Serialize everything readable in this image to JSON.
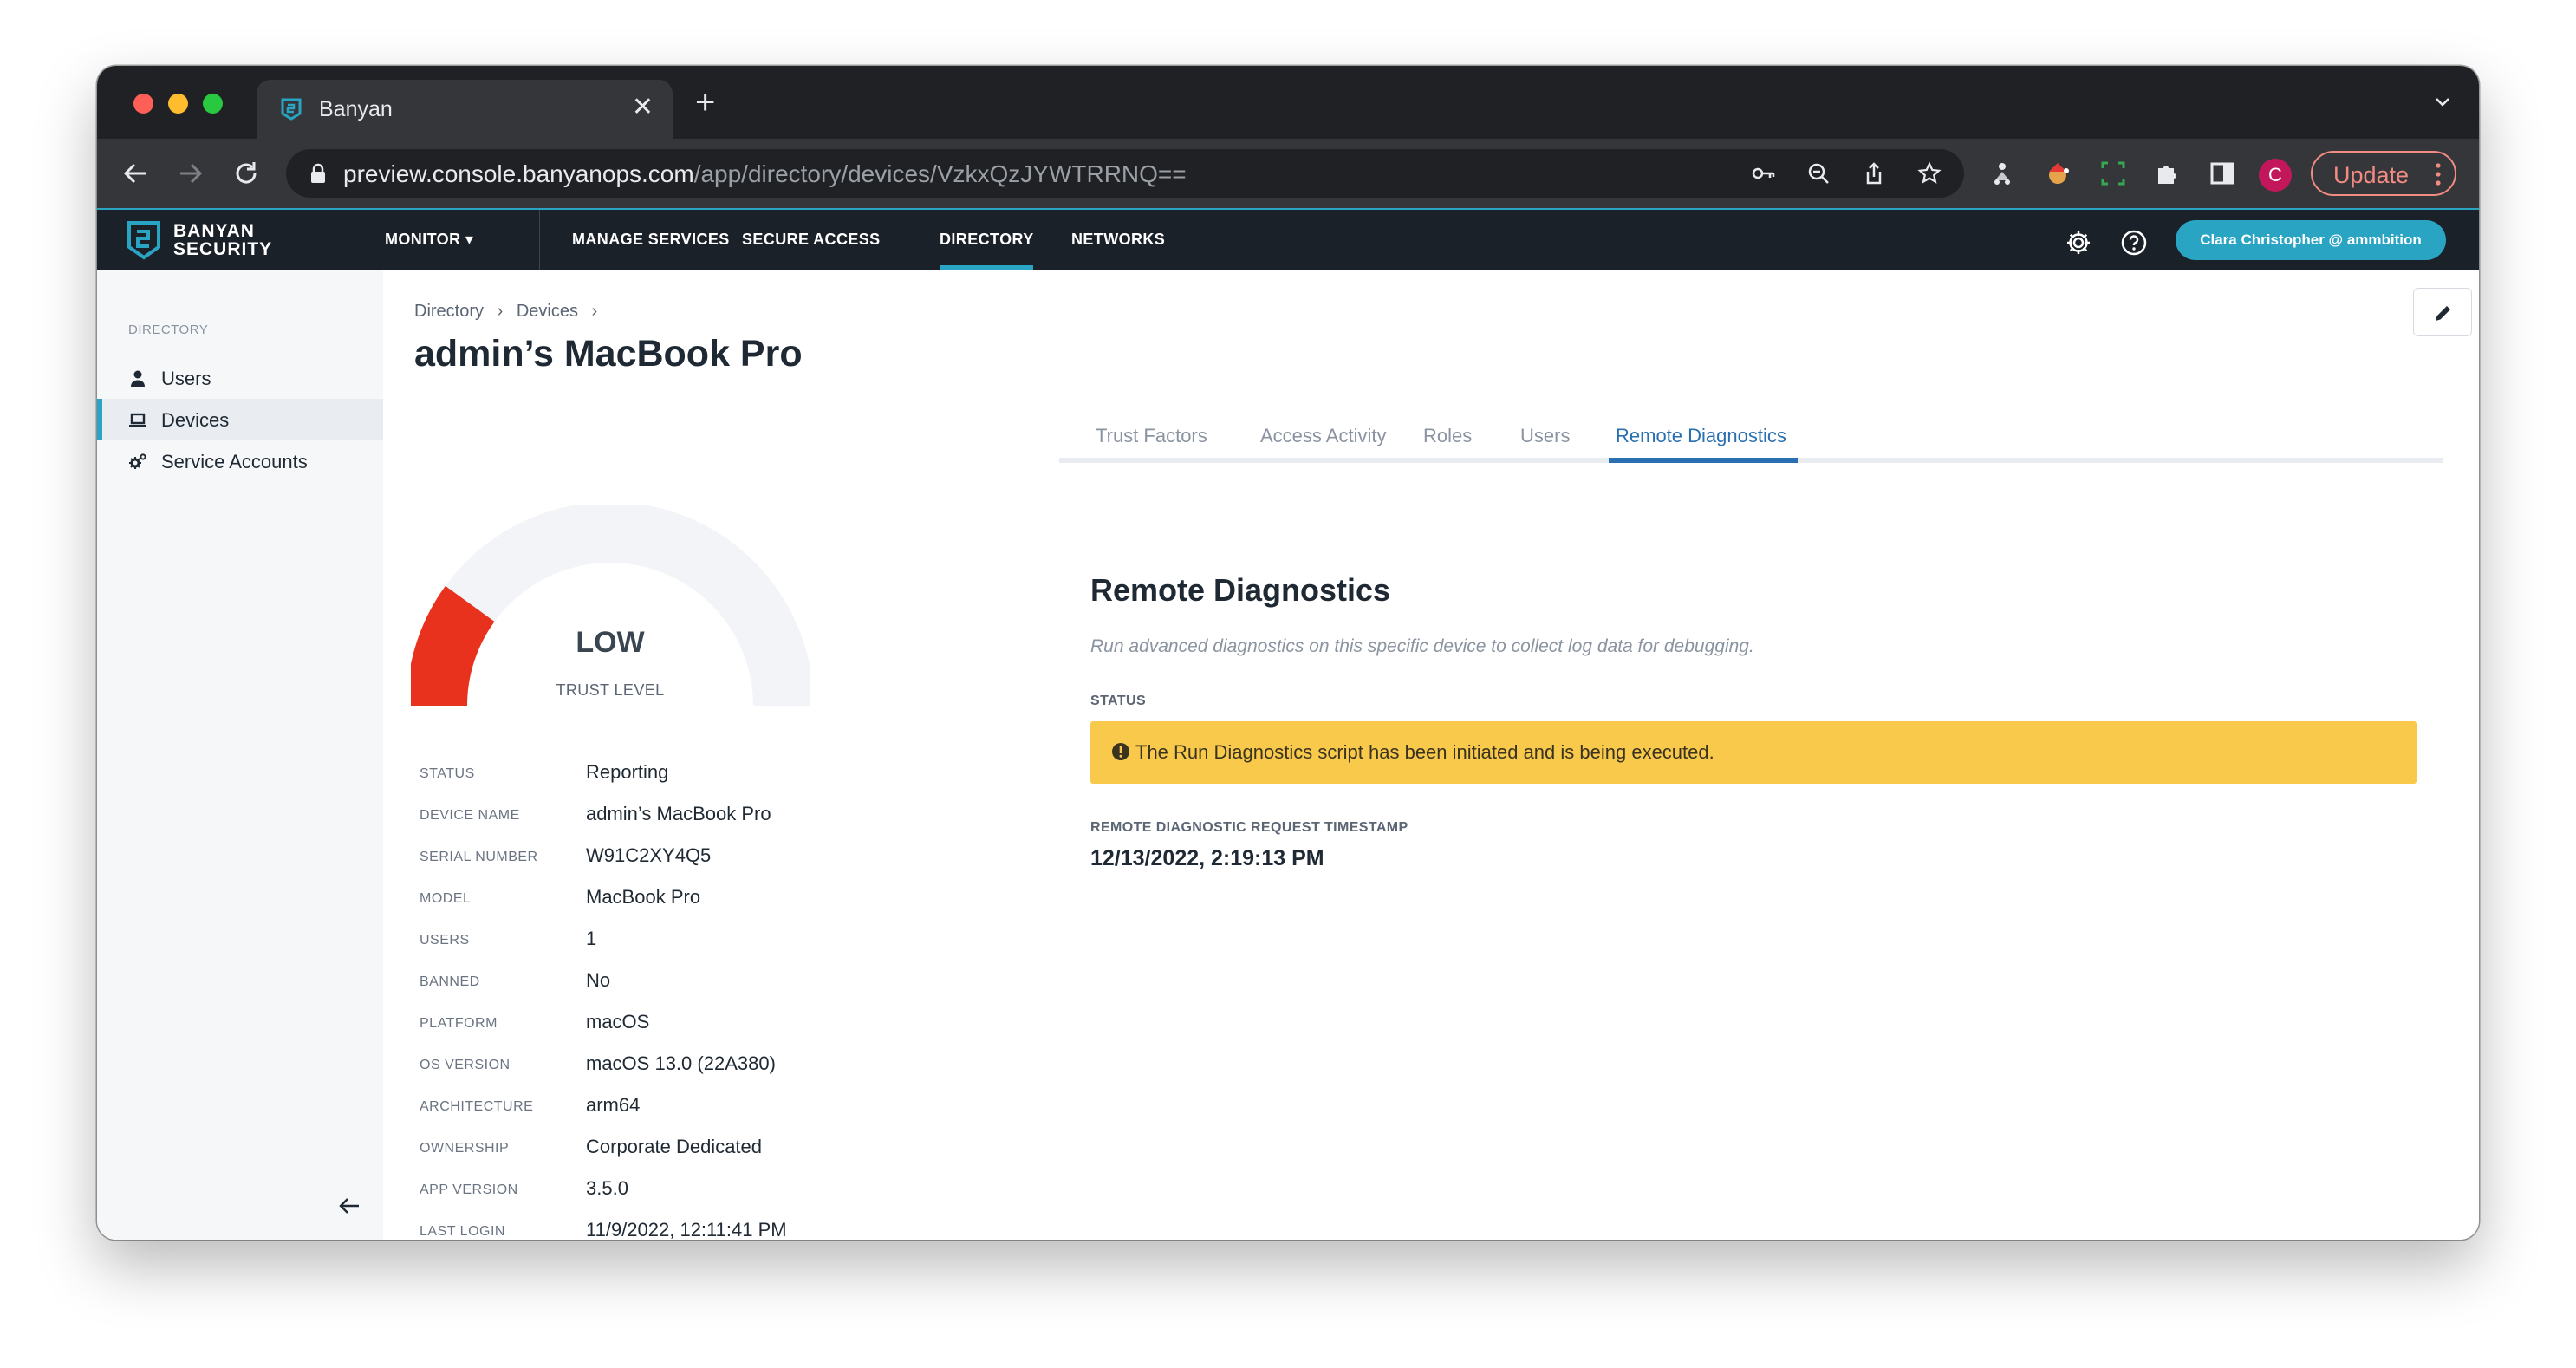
{
  "browser": {
    "tab_title": "Banyan",
    "tab_close": "✕",
    "new_tab": "+",
    "url_host": "preview.console.banyanops.com",
    "url_path": "/app/directory/devices/VzkxQzJYWTRRNQ==",
    "profile_initial": "C",
    "update_label": "Update"
  },
  "appnav": {
    "logo_line1": "BANYAN",
    "logo_line2": "SECURITY",
    "items": [
      "MONITOR",
      "MANAGE SERVICES",
      "SECURE ACCESS",
      "DIRECTORY",
      "NETWORKS"
    ],
    "monitor_caret": "▾",
    "active": "DIRECTORY",
    "user": "Clara Christopher @ ammbition",
    "accent": "#2aa4c3"
  },
  "sidebar": {
    "heading": "DIRECTORY",
    "items": [
      {
        "label": "Users",
        "icon": "user-icon"
      },
      {
        "label": "Devices",
        "icon": "laptop-icon",
        "active": true
      },
      {
        "label": "Service Accounts",
        "icon": "cogs-icon"
      }
    ]
  },
  "page": {
    "breadcrumb": [
      "Directory",
      "Devices"
    ],
    "breadcrumb_sep": "›",
    "title": "admin’s MacBook Pro"
  },
  "gauge": {
    "value": "LOW",
    "label": "TRUST LEVEL",
    "fill_fraction": 0.2,
    "fill_color": "#e8321e",
    "track_color": "#f3f4f7"
  },
  "details": [
    {
      "label": "STATUS",
      "value": "Reporting"
    },
    {
      "label": "DEVICE NAME",
      "value": "admin’s MacBook Pro"
    },
    {
      "label": "SERIAL NUMBER",
      "value": "W91C2XY4Q5"
    },
    {
      "label": "MODEL",
      "value": "MacBook Pro"
    },
    {
      "label": "USERS",
      "value": "1"
    },
    {
      "label": "BANNED",
      "value": "No"
    },
    {
      "label": "PLATFORM",
      "value": "macOS"
    },
    {
      "label": "OS VERSION",
      "value": "macOS 13.0 (22A380)"
    },
    {
      "label": "ARCHITECTURE",
      "value": "arm64"
    },
    {
      "label": "OWNERSHIP",
      "value": "Corporate Dedicated"
    },
    {
      "label": "APP VERSION",
      "value": "3.5.0"
    },
    {
      "label": "LAST LOGIN",
      "value": "11/9/2022, 12:11:41 PM"
    }
  ],
  "tabs": {
    "items": [
      "Trust Factors",
      "Access Activity",
      "Roles",
      "Users",
      "Remote Diagnostics"
    ],
    "active": "Remote Diagnostics"
  },
  "remote_diagnostics": {
    "title": "Remote Diagnostics",
    "description": "Run advanced diagnostics on this specific device to collect log data for debugging.",
    "status_label": "STATUS",
    "status_message": "The Run Diagnostics script has been initiated and is being executed.",
    "timestamp_label": "REMOTE DIAGNOSTIC REQUEST TIMESTAMP",
    "timestamp": "12/13/2022, 2:19:13 PM",
    "alert_color": "#f8c94b"
  }
}
